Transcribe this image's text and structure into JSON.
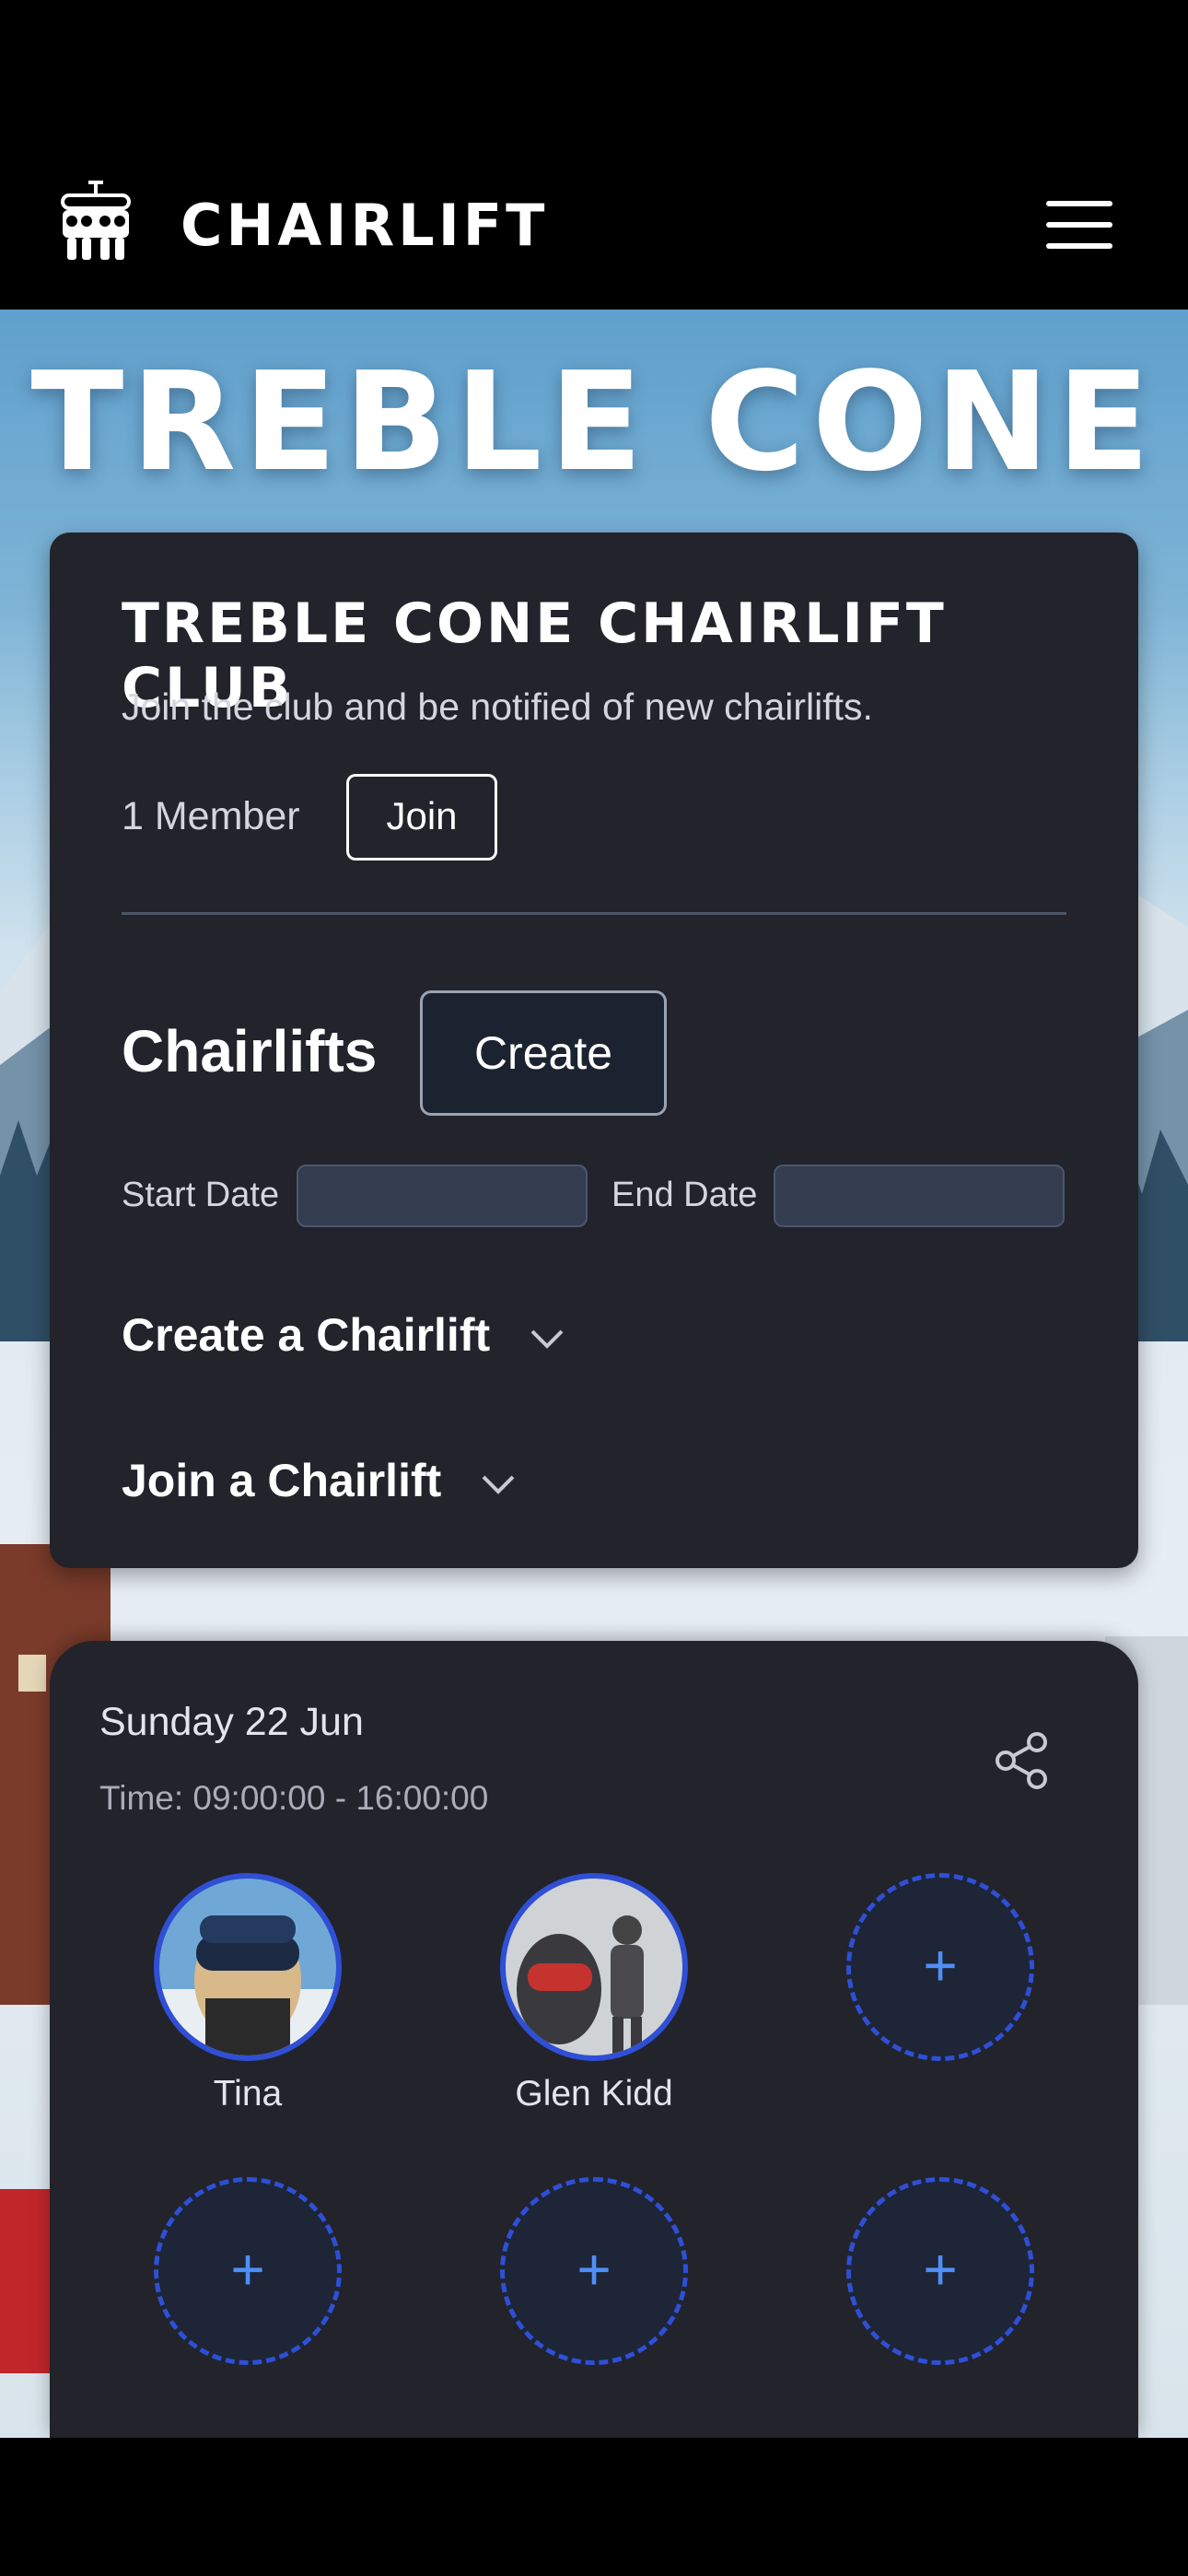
{
  "nav": {
    "brand": "CHAIRLIFT",
    "menu_icon": "hamburger-menu-icon",
    "logo_icon": "chairlift-logo-icon"
  },
  "hero": {
    "title": "TREBLE CONE"
  },
  "club": {
    "title": "TREBLE CONE CHAIRLIFT CLUB",
    "subtitle": "Join the club and be notified of new chairlifts.",
    "member_count": "1 Member",
    "join_label": "Join"
  },
  "chairlifts": {
    "heading": "Chairlifts",
    "create_label": "Create",
    "start_date_label": "Start Date",
    "end_date_label": "End Date",
    "start_date_value": "",
    "end_date_value": "",
    "create_accordion": "Create a Chairlift",
    "join_accordion": "Join a Chairlift"
  },
  "day": {
    "date": "Sunday 22 Jun",
    "time": "Time: 09:00:00 - 16:00:00",
    "share_icon": "share-icon",
    "add_symbol": "+",
    "participants": [
      {
        "name": "Tina"
      },
      {
        "name": "Glen Kidd"
      }
    ]
  },
  "colors": {
    "card_bg": "#22232b",
    "accent_blue": "#2f4fd6",
    "plus_blue": "#4f8ff7"
  }
}
